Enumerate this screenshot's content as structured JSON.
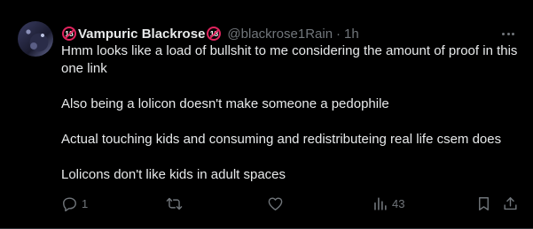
{
  "post": {
    "display_name": "Vampuric Blackrose",
    "badge_text": "18",
    "handle": "@blackrose1Rain",
    "separator": "·",
    "time": "1h",
    "paragraphs": [
      "Hmm looks like a load of bullshit to me considering the amount of proof in this one link",
      "Also being a lolicon doesn't make someone a pedophile",
      "Actual touching kids and consuming and redistributeing real life csem does",
      "Lolicons don't like kids in adult spaces"
    ],
    "stats": {
      "replies": "1",
      "reposts": "",
      "likes": "",
      "views": "43"
    }
  },
  "icons": [
    "avatar-image",
    "age-18-badge-icon",
    "more-options-icon",
    "reply-icon",
    "repost-icon",
    "like-icon",
    "views-icon",
    "bookmark-icon",
    "share-icon"
  ],
  "colors": {
    "background": "#000000",
    "text": "#e7e9ea",
    "muted": "#71767b",
    "badge": "#e0245e"
  }
}
